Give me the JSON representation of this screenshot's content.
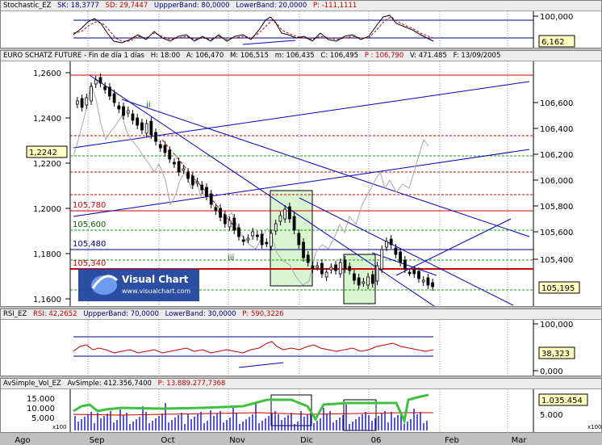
{
  "stochastic": {
    "header": {
      "name": "Stochastic_EZ",
      "sk": "SK: 18,3777",
      "sd": "SD: 29,7447",
      "upper": "UppperBand: 80,0000",
      "lower": "LowerBand: 20,0000",
      "p": "P: -111,1111"
    },
    "ticks": [
      "100,000"
    ],
    "current": "6,162"
  },
  "main": {
    "header": {
      "name": "EURO SCHATZ FUTURE - Fin de día 1 días",
      "h": "H: 18:00",
      "a": "A: 106,470",
      "m": "M: 106,515",
      "mi": "m: 106,435",
      "c": "C: 106,495",
      "p": "P : 106,790",
      "v": "V: 471.485",
      "f": "F: 13/09/2005"
    },
    "left_ticks": [
      "1,2600",
      "1,2400",
      "1,2200",
      "1,2000",
      "1,1800",
      "1,1600"
    ],
    "right_ticks": [
      "106,600",
      "106,400",
      "106,200",
      "106,000",
      "105,800",
      "105,600",
      "105,400"
    ],
    "left_current": "1,2242",
    "right_current": "105,195",
    "level_labels": [
      "105,780",
      "105,600",
      "105,480",
      "105,340"
    ],
    "wave_label": "iii",
    "wave_label2": "ii",
    "logo_title": "Visual Chart",
    "logo_url": "www.visualchart.com"
  },
  "rsi": {
    "header": {
      "name": "RSI_EZ",
      "rsi": "RSI: 42,2652",
      "upper": "UppperBand: 70,0000",
      "lower": "LowerBand: 30,0000",
      "p": "P: 590,3226"
    },
    "ticks": [
      "100,000",
      "0,000"
    ],
    "current": "38,323"
  },
  "volume": {
    "header": {
      "name": "AvSimple_Vol_EZ",
      "av": "AvSimple: 412.356,7400",
      "p": "P: 13.889.277,7368"
    },
    "left_ticks": [
      "15.000",
      "10.000",
      "5.000"
    ],
    "left_mult": "x100",
    "right_ticks": [
      "5.000"
    ],
    "right_mult": "x100",
    "current": "1.035.454"
  },
  "x_axis": [
    "Ago",
    "Sep",
    "Oct",
    "Nov",
    "Dic",
    "06",
    "Feb",
    "Mar"
  ],
  "chart_data": {
    "type": "candlestick",
    "x": [
      "Ago",
      "Sep",
      "Oct",
      "Nov",
      "Dic",
      "06",
      "Feb",
      "Mar"
    ],
    "right_axis_range": [
      105.2,
      106.8
    ],
    "left_axis_range": [
      1.16,
      1.26
    ],
    "horizontal_levels": [
      105.78,
      105.6,
      105.48,
      105.34
    ],
    "last_close": 105.195
  },
  "colors": {
    "bull": "#ffffff",
    "bear": "#000000",
    "trend": "#0000c0",
    "level": "#d00000",
    "fib": "#00a000",
    "overlay": "#a0a0a0"
  }
}
